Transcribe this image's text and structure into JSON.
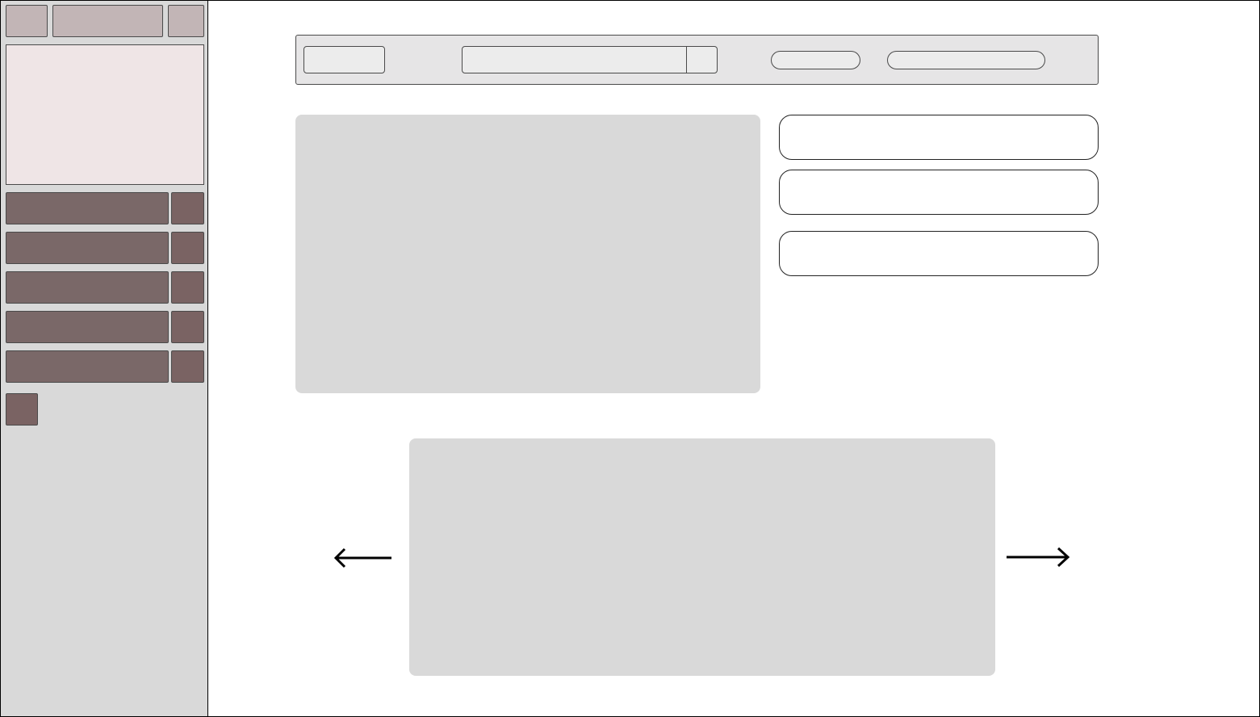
{
  "sidebar": {
    "top_buttons": [
      "",
      "",
      ""
    ],
    "rows": [
      {
        "label": "",
        "action": ""
      },
      {
        "label": "",
        "action": ""
      },
      {
        "label": "",
        "action": ""
      },
      {
        "label": "",
        "action": ""
      },
      {
        "label": "",
        "action": ""
      }
    ],
    "add_button": ""
  },
  "toolbar": {
    "first_button": "",
    "search": {
      "value": "",
      "placeholder": ""
    },
    "search_button": "",
    "pill_button_1": "",
    "pill_button_2": ""
  },
  "main": {
    "cards": [
      "",
      "",
      ""
    ]
  },
  "carousel": {
    "prev_icon": "arrow-left-icon",
    "next_icon": "arrow-right-icon"
  },
  "colors": {
    "sidebar_bg": "#d9d9d9",
    "sidebar_top_buttons": "#c2b5b6",
    "sidebar_rows": "#7a6868",
    "preview_bg": "#efe5e6",
    "toolbar_bg": "#e6e5e6",
    "pane_bg": "#d9d9d9"
  }
}
